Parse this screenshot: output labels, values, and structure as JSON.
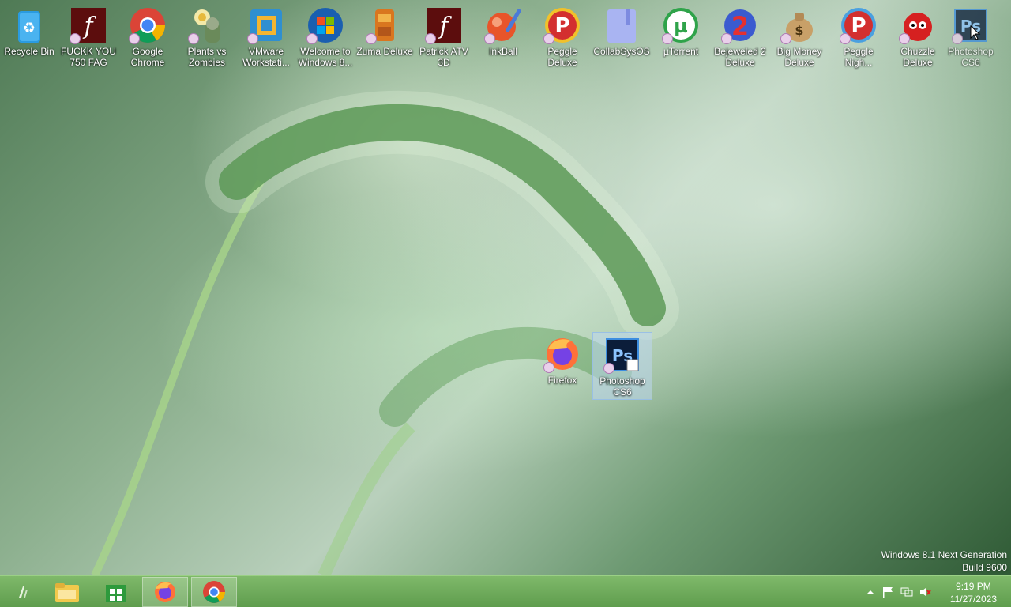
{
  "desktop": {
    "icons": [
      {
        "label": "Recycle Bin",
        "icon": "recycle-bin-icon"
      },
      {
        "label": "FUCKK YOU 750 FAG",
        "icon": "flash-icon"
      },
      {
        "label": "Google Chrome",
        "icon": "chrome-icon"
      },
      {
        "label": "Plants vs Zombies",
        "icon": "plants-vs-zombies-icon"
      },
      {
        "label": "VMware Workstati...",
        "icon": "vmware-icon"
      },
      {
        "label": "Welcome to Windows 8...",
        "icon": "windows-logo-icon"
      },
      {
        "label": "Zuma Deluxe",
        "icon": "zuma-icon"
      },
      {
        "label": "Patrick ATV 3D",
        "icon": "flash-icon"
      },
      {
        "label": "InkBall",
        "icon": "inkball-icon"
      },
      {
        "label": "Peggle Deluxe",
        "icon": "peggle-icon"
      },
      {
        "label": "CollabSysOS",
        "icon": "collabsysos-icon"
      },
      {
        "label": "µTorrent",
        "icon": "utorrent-icon"
      },
      {
        "label": "Bejeweled 2 Deluxe",
        "icon": "bejeweled-icon"
      },
      {
        "label": "Big Money Deluxe",
        "icon": "money-bag-icon"
      },
      {
        "label": "Peggle Nigh...",
        "icon": "peggle-icon"
      },
      {
        "label": "Chuzzle Deluxe",
        "icon": "chuzzle-icon"
      },
      {
        "label": "Photoshop CS6",
        "icon": "photoshop-icon"
      }
    ],
    "loose_icons": [
      {
        "label": "Firefox",
        "icon": "firefox-icon"
      },
      {
        "label": "Photoshop CS6",
        "icon": "photoshop-icon",
        "selected": true
      }
    ],
    "watermark_line1": "Windows 8.1 Next Generation",
    "watermark_line2": "Build 9600"
  },
  "taskbar": {
    "buttons": [
      {
        "name": "start-button",
        "icon": "start-icon"
      },
      {
        "name": "file-explorer",
        "icon": "folder-icon"
      },
      {
        "name": "store",
        "icon": "store-icon"
      },
      {
        "name": "firefox",
        "icon": "firefox-icon",
        "active": true
      },
      {
        "name": "chrome",
        "icon": "chrome-icon",
        "active": true
      }
    ],
    "clock": {
      "time": "9:19 PM",
      "date": "11/27/2023"
    }
  },
  "colors": {
    "taskbar": "#6aa857",
    "selection": "#bed7f0"
  }
}
